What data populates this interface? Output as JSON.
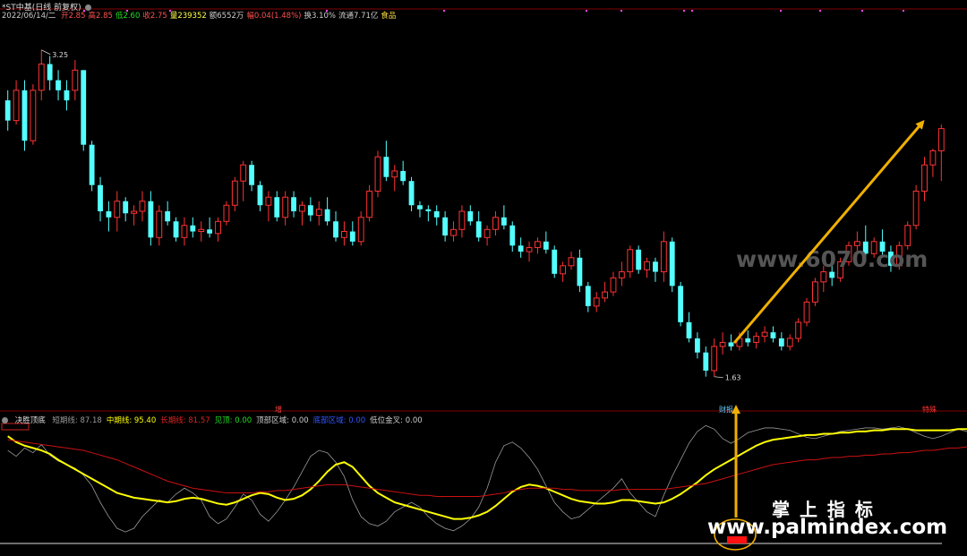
{
  "header": {
    "title": "*ST中基(日线 前复权)",
    "date": "2022/06/14/二",
    "fields": [
      {
        "label": "开",
        "value": "2.85",
        "color": "#ff5050"
      },
      {
        "label": "高",
        "value": "2.85",
        "color": "#ff5050"
      },
      {
        "label": "低",
        "value": "2.60",
        "color": "#22dd22"
      },
      {
        "label": "收",
        "value": "2.75",
        "color": "#ff5050"
      },
      {
        "label": "量",
        "value": "239352",
        "color": "#ffff44"
      },
      {
        "label": "额",
        "value": "6552万",
        "color": "#cccccc"
      },
      {
        "label": "幅",
        "value": "0.04(1.48%)",
        "color": "#ff5050"
      },
      {
        "label": "换",
        "value": "3.10%",
        "color": "#cccccc"
      },
      {
        "label": "流通",
        "value": "7.71亿",
        "color": "#cccccc"
      },
      {
        "label": "",
        "value": "食品",
        "color": "#ffdd44"
      }
    ]
  },
  "indicator": {
    "name": "决胜顶底",
    "fields": [
      {
        "label": "短期线:",
        "value": "87.18",
        "color": "#999999"
      },
      {
        "label": "中期线:",
        "value": "95.40",
        "color": "#ffff00"
      },
      {
        "label": "长期线:",
        "value": "81.57",
        "color": "#dd2222"
      },
      {
        "label": "见顶:",
        "value": "0.00",
        "color": "#22dd22"
      },
      {
        "label": "顶部区域:",
        "value": "0.00",
        "color": "#cccccc"
      },
      {
        "label": "底部区域:",
        "value": "0.00",
        "color": "#3355ff"
      },
      {
        "label": "低位金叉:",
        "value": "0.00",
        "color": "#cccccc"
      }
    ]
  },
  "annotations": {
    "high_price": "3.25",
    "low_price": "1.63",
    "mark_zeng": "增",
    "mark_caibao": "财报",
    "mark_teshu": "特殊"
  },
  "watermarks": {
    "mid": "www.6070.com",
    "cn": "掌 上 指 标",
    "url": "www.palmindex.com"
  },
  "colors": {
    "up": "#ff3333",
    "down": "#54ffff",
    "short_line": "#999999",
    "mid_line": "#ffff00",
    "long_line": "#cc1111",
    "arrow": "#f0b000"
  },
  "chart_data": [
    {
      "type": "candlestick",
      "title": "*ST中基(日线 前复权)",
      "ylim": [
        1.5,
        3.4
      ],
      "annotations": [
        {
          "label": "3.25",
          "value": 3.25
        },
        {
          "label": "1.63",
          "value": 1.63
        }
      ],
      "candles": [
        [
          3.0,
          3.05,
          2.85,
          2.9
        ],
        [
          2.9,
          3.1,
          2.88,
          3.05
        ],
        [
          3.05,
          3.1,
          2.75,
          2.8
        ],
        [
          2.8,
          3.08,
          2.78,
          3.05
        ],
        [
          3.05,
          3.25,
          3.0,
          3.18
        ],
        [
          3.18,
          3.22,
          3.05,
          3.1
        ],
        [
          3.1,
          3.15,
          3.0,
          3.05
        ],
        [
          3.05,
          3.1,
          2.95,
          3.0
        ],
        [
          3.05,
          3.2,
          3.0,
          3.15
        ],
        [
          3.15,
          3.15,
          2.75,
          2.78
        ],
        [
          2.78,
          2.8,
          2.55,
          2.58
        ],
        [
          2.58,
          2.62,
          2.4,
          2.45
        ],
        [
          2.45,
          2.5,
          2.35,
          2.42
        ],
        [
          2.42,
          2.55,
          2.35,
          2.5
        ],
        [
          2.5,
          2.52,
          2.4,
          2.44
        ],
        [
          2.44,
          2.48,
          2.38,
          2.45
        ],
        [
          2.45,
          2.55,
          2.4,
          2.5
        ],
        [
          2.5,
          2.55,
          2.28,
          2.32
        ],
        [
          2.32,
          2.48,
          2.28,
          2.45
        ],
        [
          2.45,
          2.5,
          2.38,
          2.4
        ],
        [
          2.4,
          2.42,
          2.3,
          2.32
        ],
        [
          2.32,
          2.42,
          2.28,
          2.38
        ],
        [
          2.38,
          2.42,
          2.32,
          2.35
        ],
        [
          2.35,
          2.4,
          2.3,
          2.36
        ],
        [
          2.36,
          2.42,
          2.32,
          2.34
        ],
        [
          2.34,
          2.42,
          2.3,
          2.4
        ],
        [
          2.4,
          2.5,
          2.38,
          2.48
        ],
        [
          2.48,
          2.62,
          2.45,
          2.6
        ],
        [
          2.6,
          2.7,
          2.5,
          2.68
        ],
        [
          2.68,
          2.7,
          2.55,
          2.58
        ],
        [
          2.58,
          2.6,
          2.45,
          2.48
        ],
        [
          2.48,
          2.55,
          2.4,
          2.52
        ],
        [
          2.52,
          2.55,
          2.4,
          2.42
        ],
        [
          2.42,
          2.55,
          2.38,
          2.52
        ],
        [
          2.52,
          2.55,
          2.42,
          2.45
        ],
        [
          2.45,
          2.5,
          2.38,
          2.48
        ],
        [
          2.48,
          2.52,
          2.4,
          2.43
        ],
        [
          2.43,
          2.5,
          2.38,
          2.46
        ],
        [
          2.46,
          2.52,
          2.38,
          2.4
        ],
        [
          2.4,
          2.45,
          2.3,
          2.32
        ],
        [
          2.32,
          2.4,
          2.28,
          2.35
        ],
        [
          2.35,
          2.4,
          2.28,
          2.3
        ],
        [
          2.3,
          2.45,
          2.28,
          2.42
        ],
        [
          2.42,
          2.58,
          2.4,
          2.55
        ],
        [
          2.55,
          2.75,
          2.52,
          2.72
        ],
        [
          2.72,
          2.8,
          2.6,
          2.62
        ],
        [
          2.62,
          2.68,
          2.55,
          2.65
        ],
        [
          2.65,
          2.7,
          2.58,
          2.6
        ],
        [
          2.6,
          2.62,
          2.45,
          2.48
        ],
        [
          2.48,
          2.5,
          2.42,
          2.46
        ],
        [
          2.46,
          2.48,
          2.4,
          2.45
        ],
        [
          2.45,
          2.48,
          2.38,
          2.42
        ],
        [
          2.42,
          2.45,
          2.3,
          2.33
        ],
        [
          2.33,
          2.4,
          2.3,
          2.36
        ],
        [
          2.36,
          2.48,
          2.32,
          2.45
        ],
        [
          2.45,
          2.48,
          2.38,
          2.4
        ],
        [
          2.4,
          2.45,
          2.3,
          2.32
        ],
        [
          2.32,
          2.38,
          2.28,
          2.36
        ],
        [
          2.36,
          2.45,
          2.33,
          2.42
        ],
        [
          2.42,
          2.48,
          2.36,
          2.38
        ],
        [
          2.38,
          2.4,
          2.25,
          2.28
        ],
        [
          2.28,
          2.32,
          2.22,
          2.25
        ],
        [
          2.25,
          2.3,
          2.2,
          2.27
        ],
        [
          2.27,
          2.32,
          2.24,
          2.3
        ],
        [
          2.3,
          2.35,
          2.24,
          2.26
        ],
        [
          2.26,
          2.28,
          2.12,
          2.14
        ],
        [
          2.14,
          2.2,
          2.1,
          2.18
        ],
        [
          2.18,
          2.25,
          2.16,
          2.22
        ],
        [
          2.22,
          2.26,
          2.05,
          2.08
        ],
        [
          2.08,
          2.1,
          1.95,
          1.98
        ],
        [
          1.98,
          2.05,
          1.95,
          2.02
        ],
        [
          2.02,
          2.1,
          2.0,
          2.05
        ],
        [
          2.05,
          2.15,
          2.03,
          2.12
        ],
        [
          2.12,
          2.2,
          2.08,
          2.15
        ],
        [
          2.15,
          2.28,
          2.12,
          2.26
        ],
        [
          2.26,
          2.28,
          2.14,
          2.16
        ],
        [
          2.16,
          2.22,
          2.12,
          2.2
        ],
        [
          2.2,
          2.22,
          2.1,
          2.15
        ],
        [
          2.15,
          2.35,
          2.1,
          2.3
        ],
        [
          2.3,
          2.32,
          2.05,
          2.08
        ],
        [
          2.08,
          2.1,
          1.88,
          1.9
        ],
        [
          1.9,
          1.95,
          1.8,
          1.82
        ],
        [
          1.82,
          1.85,
          1.72,
          1.75
        ],
        [
          1.75,
          1.78,
          1.63,
          1.66
        ],
        [
          1.66,
          1.82,
          1.63,
          1.78
        ],
        [
          1.78,
          1.85,
          1.74,
          1.8
        ],
        [
          1.8,
          1.84,
          1.76,
          1.78
        ],
        [
          1.78,
          1.85,
          1.76,
          1.82
        ],
        [
          1.82,
          1.86,
          1.78,
          1.8
        ],
        [
          1.8,
          1.85,
          1.77,
          1.83
        ],
        [
          1.83,
          1.88,
          1.8,
          1.85
        ],
        [
          1.85,
          1.88,
          1.8,
          1.82
        ],
        [
          1.82,
          1.85,
          1.76,
          1.78
        ],
        [
          1.78,
          1.84,
          1.76,
          1.82
        ],
        [
          1.82,
          1.92,
          1.8,
          1.9
        ],
        [
          1.9,
          2.02,
          1.88,
          2.0
        ],
        [
          2.0,
          2.12,
          1.98,
          2.1
        ],
        [
          2.1,
          2.18,
          2.05,
          2.15
        ],
        [
          2.15,
          2.2,
          2.08,
          2.12
        ],
        [
          2.12,
          2.22,
          2.1,
          2.2
        ],
        [
          2.2,
          2.3,
          2.18,
          2.28
        ],
        [
          2.28,
          2.35,
          2.24,
          2.3
        ],
        [
          2.3,
          2.38,
          2.2,
          2.24
        ],
        [
          2.24,
          2.32,
          2.22,
          2.3
        ],
        [
          2.3,
          2.36,
          2.22,
          2.25
        ],
        [
          2.25,
          2.28,
          2.15,
          2.18
        ],
        [
          2.18,
          2.3,
          2.16,
          2.28
        ],
        [
          2.28,
          2.4,
          2.26,
          2.38
        ],
        [
          2.38,
          2.58,
          2.36,
          2.55
        ],
        [
          2.55,
          2.72,
          2.5,
          2.68
        ],
        [
          2.68,
          2.76,
          2.62,
          2.75
        ],
        [
          2.75,
          2.88,
          2.6,
          2.86
        ]
      ]
    },
    {
      "type": "line",
      "title": "决胜顶底",
      "ylim": [
        0,
        100
      ],
      "series": [
        {
          "name": "短期线",
          "values": [
            78,
            73,
            80,
            76,
            83,
            74,
            69,
            66,
            63,
            57,
            48,
            34,
            22,
            12,
            9,
            12,
            22,
            29,
            36,
            34,
            41,
            46,
            42,
            36,
            22,
            16,
            20,
            30,
            41,
            36,
            24,
            18,
            26,
            36,
            47,
            60,
            73,
            78,
            76,
            68,
            56,
            36,
            22,
            16,
            14,
            18,
            26,
            30,
            34,
            30,
            22,
            16,
            12,
            10,
            14,
            20,
            30,
            46,
            68,
            82,
            85,
            80,
            72,
            62,
            48,
            34,
            26,
            20,
            22,
            28,
            34,
            40,
            46,
            54,
            42,
            34,
            26,
            22,
            40,
            56,
            70,
            84,
            94,
            99,
            96,
            88,
            84,
            88,
            93,
            95,
            97,
            97,
            96,
            95,
            92,
            89,
            88,
            90,
            92,
            94,
            95,
            96,
            97,
            97,
            96,
            97,
            98,
            96,
            93,
            90,
            88,
            90,
            93,
            96,
            94,
            87
          ]
        },
        {
          "name": "中期线",
          "values": [
            90,
            85,
            82,
            80,
            78,
            75,
            70,
            66,
            62,
            58,
            54,
            50,
            46,
            42,
            40,
            38,
            37,
            36,
            35,
            34,
            35,
            37,
            38,
            37,
            35,
            33,
            32,
            34,
            37,
            40,
            42,
            41,
            38,
            36,
            37,
            40,
            45,
            52,
            60,
            66,
            68,
            64,
            56,
            48,
            42,
            38,
            34,
            32,
            30,
            28,
            26,
            24,
            22,
            20,
            20,
            21,
            23,
            26,
            31,
            37,
            43,
            47,
            49,
            48,
            46,
            43,
            40,
            37,
            35,
            34,
            33,
            33,
            34,
            36,
            36,
            35,
            34,
            33,
            34,
            37,
            41,
            46,
            51,
            57,
            62,
            66,
            70,
            74,
            78,
            82,
            85,
            87,
            88,
            89,
            90,
            91,
            91,
            92,
            92,
            93,
            93,
            94,
            94,
            95,
            95,
            96,
            96,
            96,
            95,
            95,
            95,
            95,
            95,
            96,
            96,
            95
          ]
        },
        {
          "name": "长期线",
          "values": [
            87,
            86,
            85,
            84,
            83,
            82,
            81,
            80,
            79,
            78,
            76,
            74,
            72,
            70,
            67,
            64,
            61,
            58,
            55,
            52,
            50,
            48,
            46,
            45,
            44,
            43,
            42,
            42,
            42,
            42,
            43,
            43,
            44,
            44,
            45,
            46,
            47,
            48,
            49,
            49,
            49,
            48,
            47,
            46,
            45,
            44,
            43,
            42,
            41,
            40,
            40,
            39,
            39,
            39,
            39,
            39,
            39,
            40,
            41,
            42,
            44,
            45,
            46,
            46,
            46,
            46,
            45,
            45,
            44,
            44,
            44,
            44,
            44,
            45,
            45,
            45,
            45,
            45,
            45,
            46,
            47,
            48,
            49,
            50,
            52,
            54,
            56,
            58,
            60,
            62,
            64,
            66,
            67,
            68,
            69,
            70,
            70,
            71,
            72,
            72,
            73,
            73,
            74,
            74,
            75,
            75,
            76,
            76,
            77,
            78,
            78,
            79,
            80,
            80,
            81,
            82
          ]
        }
      ]
    }
  ]
}
